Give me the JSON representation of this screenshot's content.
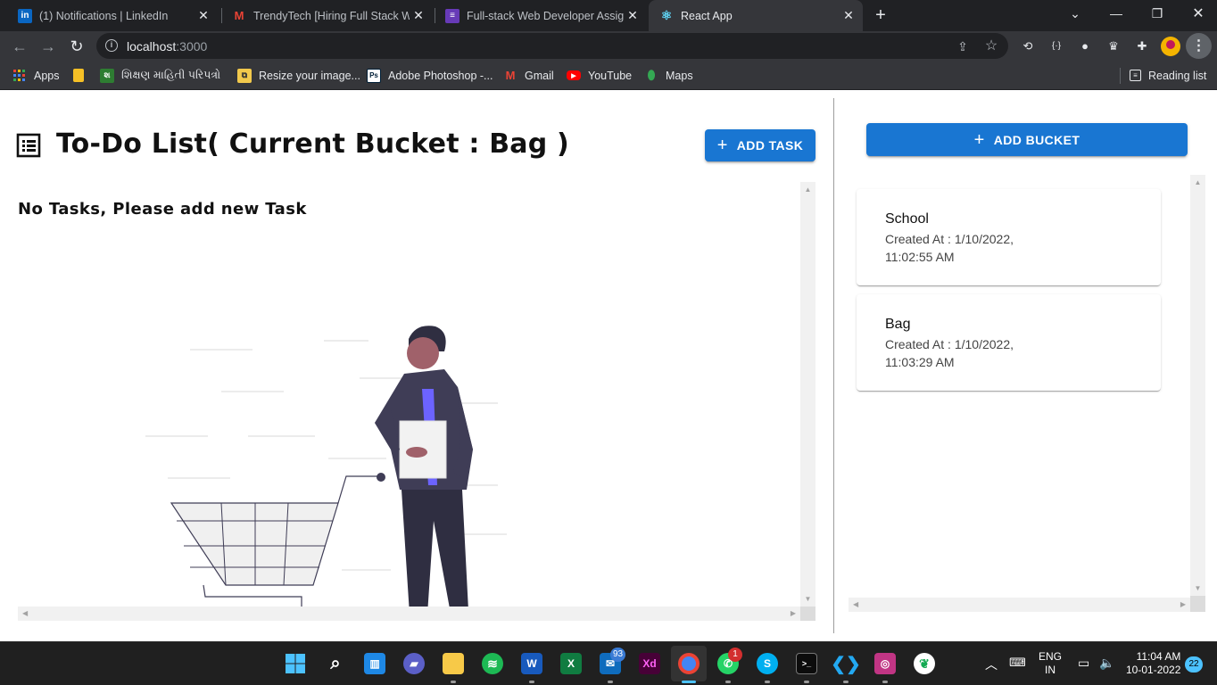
{
  "browser": {
    "tabs": [
      {
        "title": "(1) Notifications | LinkedIn",
        "icon": "linkedin-icon",
        "active": false
      },
      {
        "title": "TrendyTech [Hiring Full Stack Web",
        "icon": "gmail-icon",
        "active": false
      },
      {
        "title": "Full-stack Web Developer Assign",
        "icon": "forms-icon",
        "active": false
      },
      {
        "title": "React App",
        "icon": "react-icon",
        "active": true
      }
    ],
    "new_tab_label": "+",
    "address": {
      "host": "localhost",
      "port": ":3000"
    },
    "bookmarks": [
      {
        "label": "Apps",
        "icon": "apps-grid-icon"
      },
      {
        "label": "",
        "icon": "folder-icon"
      },
      {
        "label": "શિક્ષણ માહિતી પરિપત્રો",
        "icon": "gujarat-edu-icon"
      },
      {
        "label": "Resize your image...",
        "icon": "resize-icon"
      },
      {
        "label": "Adobe Photoshop -...",
        "icon": "photoshop-icon"
      },
      {
        "label": "Gmail",
        "icon": "gmail-icon"
      },
      {
        "label": "YouTube",
        "icon": "youtube-icon"
      },
      {
        "label": "Maps",
        "icon": "maps-icon"
      }
    ],
    "reading_list_label": "Reading list"
  },
  "app": {
    "title": "To-Do List( Current Bucket : Bag )",
    "add_task_label": "ADD TASK",
    "empty_message": "No Tasks, Please add new Task",
    "add_bucket_label": "ADD BUCKET",
    "buckets": [
      {
        "name": "School",
        "created": "Created At : 1/10/2022, 11:02:55 AM"
      },
      {
        "name": "Bag",
        "created": "Created At : 1/10/2022, 11:03:29 AM"
      }
    ]
  },
  "taskbar": {
    "apps": [
      "start",
      "search",
      "widgets",
      "teams-chat",
      "file-explorer",
      "spotify",
      "word",
      "excel",
      "mail",
      "adobe-xd",
      "chrome",
      "whatsapp",
      "skype",
      "terminal",
      "vscode",
      "instagram",
      "mongodb"
    ],
    "mail_badge": "93",
    "whatsapp_badge": "1",
    "language": "ENG",
    "region": "IN",
    "time": "11:04 AM",
    "date": "10-01-2022",
    "notification_count": "22"
  },
  "colors": {
    "primary": "#1976d2",
    "illustration_accent": "#6c63ff",
    "illustration_dark": "#3f3d56"
  }
}
